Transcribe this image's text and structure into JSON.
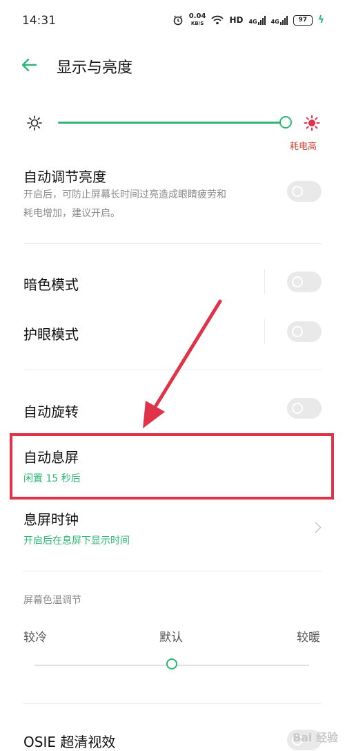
{
  "status_bar": {
    "time": "14:31",
    "speed_value": "0.04",
    "speed_unit": "KB/S",
    "hd_label": "HD",
    "signal_tag": "4G",
    "battery": "97"
  },
  "header": {
    "back_icon": "back-arrow-icon",
    "title": "显示与亮度"
  },
  "brightness": {
    "level_percent": 100,
    "high_power_hint": "耗电高"
  },
  "auto_brightness": {
    "title": "自动调节亮度",
    "description_line1": "开启后，可防止屏幕长时间过亮造成眼睛疲劳和",
    "description_line2": "耗电增加，建议开启。",
    "enabled": false
  },
  "dark_mode": {
    "title": "暗色模式",
    "enabled": false
  },
  "eye_comfort": {
    "title": "护眼模式",
    "enabled": false
  },
  "auto_rotate": {
    "title": "自动旋转",
    "enabled": false
  },
  "screen_timeout": {
    "title": "自动息屏",
    "value": "闲置 15 秒后"
  },
  "aod": {
    "title": "息屏时钟",
    "subtitle": "开启后在息屏下显示时间"
  },
  "color_temp": {
    "section_label": "屏幕色温调节",
    "cool_label": "较冷",
    "default_label": "默认",
    "warm_label": "较暖",
    "position_percent": 50
  },
  "osie": {
    "title": "OSIE 超清视效"
  },
  "watermark": "Bai 经验",
  "colors": {
    "accent": "#2bb673",
    "annotation": "#e03248",
    "warning": "#c84a3a"
  }
}
